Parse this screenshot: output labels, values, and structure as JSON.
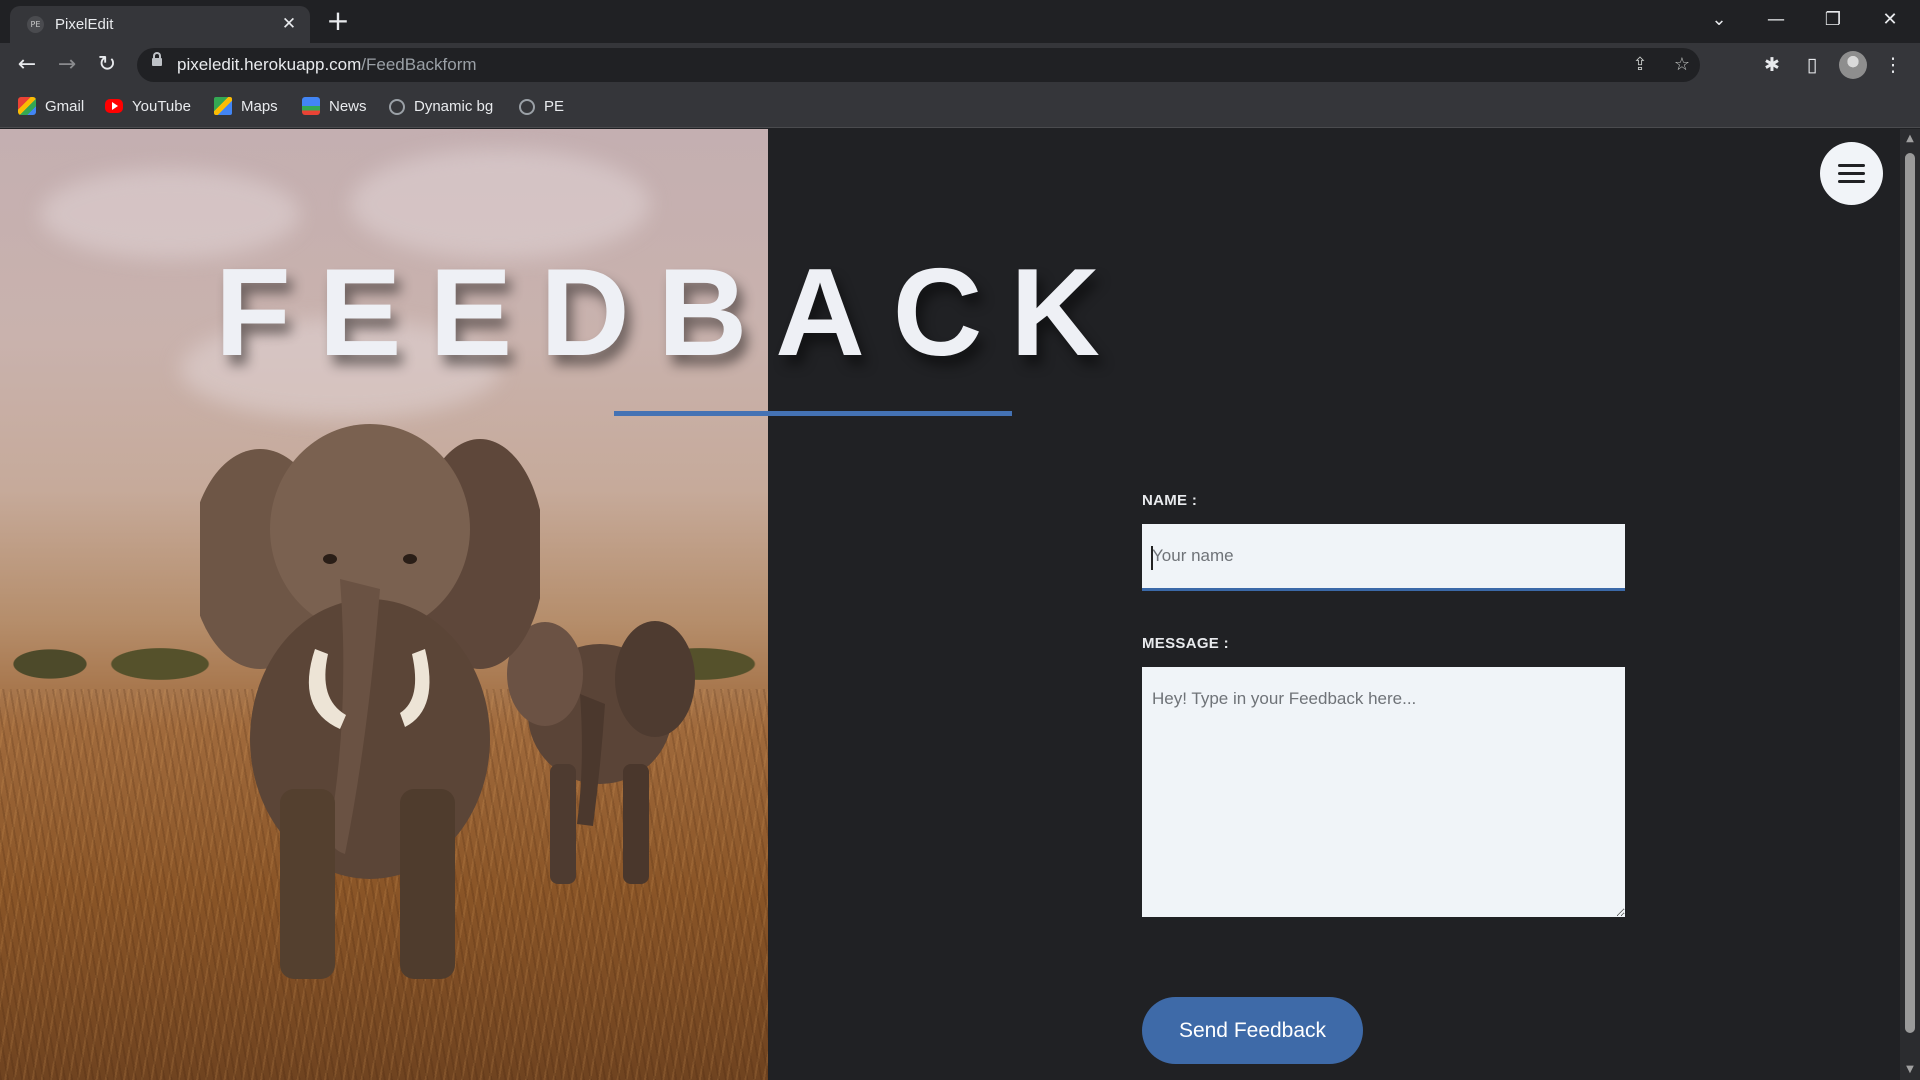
{
  "browser": {
    "tab": {
      "title": "PixelEdit",
      "favicon": "PE",
      "close_glyph": "✕"
    },
    "new_tab_glyph": "+",
    "window_controls": {
      "tab_search": "⌄",
      "minimize": "—",
      "restore": "❐",
      "close": "✕"
    },
    "nav": {
      "back": "←",
      "forward": "→",
      "reload": "↻"
    },
    "address": {
      "host": "pixeledit.herokuapp.com",
      "path": "/FeedBackform"
    },
    "toolbar_icons": {
      "share": "⇪",
      "bookmark": "☆",
      "extensions": "✱",
      "side_panel": "▯",
      "menu": "⋮"
    },
    "bookmarks": [
      {
        "label": "Gmail",
        "icon": "gmail-icon"
      },
      {
        "label": "YouTube",
        "icon": "youtube-icon"
      },
      {
        "label": "Maps",
        "icon": "maps-icon"
      },
      {
        "label": "News",
        "icon": "news-icon"
      },
      {
        "label": "Dynamic bg",
        "icon": "globe-icon"
      },
      {
        "label": "PE",
        "icon": "globe-icon"
      }
    ]
  },
  "page": {
    "heading": "FEEDBACK",
    "accent_color": "#4472b4",
    "background_color": "#202124",
    "form": {
      "name_label": "NAME :",
      "name_placeholder": "Your name",
      "name_value": "",
      "message_label": "MESSAGE :",
      "message_placeholder": "Hey! Type in your Feedback here...",
      "message_value": "",
      "submit_label": "Send Feedback"
    }
  }
}
